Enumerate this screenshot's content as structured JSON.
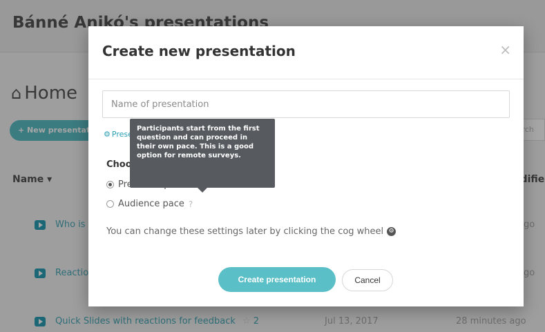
{
  "background": {
    "page_title": "Bánné Anikó's presentations",
    "home_label": "Home",
    "new_button_label": "+ New presentation",
    "search_placeholder": "Search",
    "columns": {
      "name": "Name",
      "modified": "Modified"
    },
    "rows": [
      {
        "name": "Who is ...",
        "modified": "ago"
      },
      {
        "name": "Reactions ...",
        "modified": "ago"
      },
      {
        "name": "Quick Slides with reactions for feedback",
        "count": "2",
        "created": "Jul 13, 2017",
        "modified": "28 minutes ago"
      }
    ]
  },
  "modal": {
    "title": "Create new presentation",
    "close_symbol": "×",
    "name_input": {
      "placeholder": "Name of presentation",
      "value": ""
    },
    "settings_link_label": "Presentation settings",
    "choose_label": "Choose pace:",
    "options": [
      {
        "label": "Presenter pace",
        "help": "?",
        "checked": true
      },
      {
        "label": "Audience pace",
        "help": "?",
        "checked": false
      }
    ],
    "note": "You can change these settings later by clicking the cog wheel",
    "create_button": "Create presentation",
    "cancel_button": "Cancel",
    "tooltip_text": "Participants start from the first question and can proceed in their own pace. This is a good option for remote surveys."
  },
  "colors": {
    "accent": "#5bbfc7",
    "link": "#2a9fb6",
    "tooltip_bg": "#575b60"
  }
}
